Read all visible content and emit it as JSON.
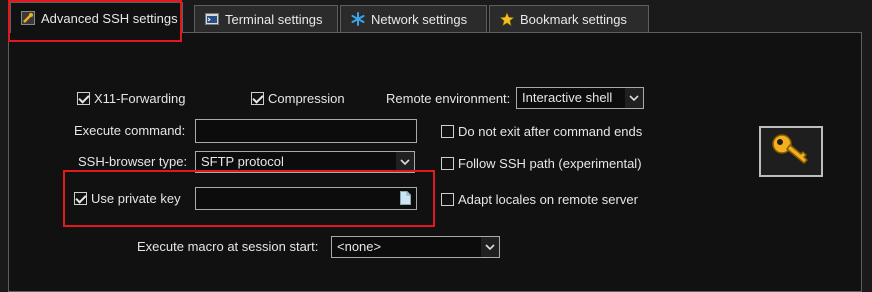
{
  "tabs": [
    {
      "label": "Advanced SSH settings",
      "icon": "wrench-icon"
    },
    {
      "label": "Terminal settings",
      "icon": "terminal-icon"
    },
    {
      "label": "Network settings",
      "icon": "network-icon"
    },
    {
      "label": "Bookmark settings",
      "icon": "star-icon"
    }
  ],
  "options": {
    "x11_forwarding": {
      "label": "X11-Forwarding",
      "checked": true
    },
    "compression": {
      "label": "Compression",
      "checked": true
    },
    "remote_env": {
      "label": "Remote environment:",
      "value": "Interactive shell"
    },
    "execute_command": {
      "label": "Execute command:",
      "value": ""
    },
    "ssh_browser": {
      "label": "SSH-browser type:",
      "value": "SFTP protocol"
    },
    "private_key": {
      "label": "Use private key",
      "checked": true,
      "value": ""
    },
    "macro": {
      "label": "Execute macro at session start:",
      "value": "<none>"
    },
    "no_exit": {
      "label": "Do not exit after command ends",
      "checked": false
    },
    "follow_path": {
      "label": "Follow SSH path (experimental)",
      "checked": false
    },
    "adapt_locales": {
      "label": "Adapt locales on remote server",
      "checked": false
    }
  },
  "side_button": {
    "icon": "key-icon"
  },
  "colors": {
    "highlight": "#e0191e",
    "key": "#f2b01e",
    "background": "#111111"
  }
}
